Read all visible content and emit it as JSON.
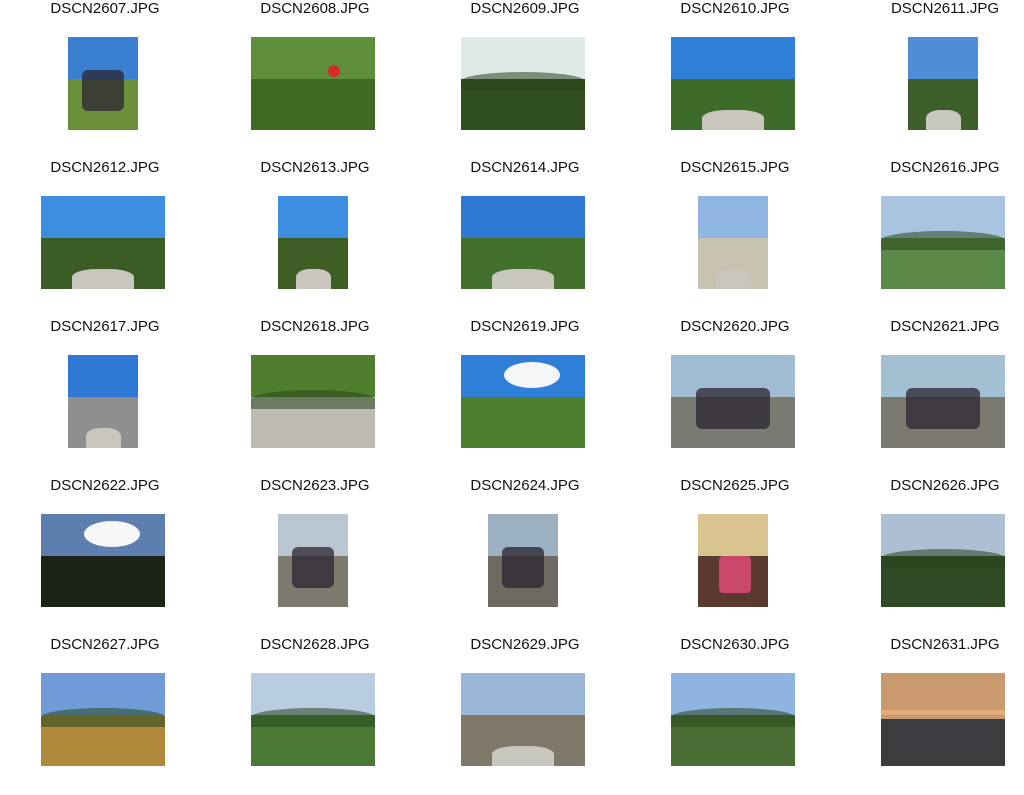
{
  "gallery": {
    "items": [
      {
        "filename": "DSCN2607.JPG",
        "orientation": "portrait",
        "scene": "people-grass",
        "sky": "#3a7fd0",
        "land": "#6c8f3c"
      },
      {
        "filename": "DSCN2608.JPG",
        "orientation": "landscape",
        "scene": "berry",
        "sky": "#5f8f3a",
        "land": "#3e6a22"
      },
      {
        "filename": "DSCN2609.JPG",
        "orientation": "landscape",
        "scene": "trees",
        "sky": "#dfe9e6",
        "land": "#2f4f1e"
      },
      {
        "filename": "DSCN2610.JPG",
        "orientation": "landscape",
        "scene": "hills-road",
        "sky": "#2f7fd8",
        "land": "#3d6b2a"
      },
      {
        "filename": "DSCN2611.JPG",
        "orientation": "portrait",
        "scene": "road-cliff",
        "sky": "#4f8ed6",
        "land": "#3e5f2a"
      },
      {
        "filename": "DSCN2612.JPG",
        "orientation": "landscape",
        "scene": "road-cliff",
        "sky": "#3d8de0",
        "land": "#3b5c25"
      },
      {
        "filename": "DSCN2613.JPG",
        "orientation": "portrait",
        "scene": "road-cliff",
        "sky": "#3d8de0",
        "land": "#3f5e26"
      },
      {
        "filename": "DSCN2614.JPG",
        "orientation": "landscape",
        "scene": "hills-road",
        "sky": "#2f78d4",
        "land": "#44702d"
      },
      {
        "filename": "DSCN2615.JPG",
        "orientation": "portrait",
        "scene": "person-road",
        "sky": "#8fb6e3",
        "land": "#c8c2b0"
      },
      {
        "filename": "DSCN2616.JPG",
        "orientation": "landscape",
        "scene": "valley",
        "sky": "#a9c4e0",
        "land": "#5b8a48"
      },
      {
        "filename": "DSCN2617.JPG",
        "orientation": "portrait",
        "scene": "person-road",
        "sky": "#2f78d4",
        "land": "#8f8f8f"
      },
      {
        "filename": "DSCN2618.JPG",
        "orientation": "landscape",
        "scene": "waterfall",
        "sky": "#4f7f2d",
        "land": "#bdbbb2"
      },
      {
        "filename": "DSCN2619.JPG",
        "orientation": "landscape",
        "scene": "garden",
        "sky": "#2f7fd8",
        "land": "#4b7f2e"
      },
      {
        "filename": "DSCN2620.JPG",
        "orientation": "landscape",
        "scene": "group",
        "sky": "#9fbcd0",
        "land": "#7a7a72"
      },
      {
        "filename": "DSCN2621.JPG",
        "orientation": "landscape",
        "scene": "group",
        "sky": "#a3bfd2",
        "land": "#7c7a70"
      },
      {
        "filename": "DSCN2622.JPG",
        "orientation": "landscape",
        "scene": "clouds",
        "sky": "#5d7fb0",
        "land": "#1c2418"
      },
      {
        "filename": "DSCN2623.JPG",
        "orientation": "portrait",
        "scene": "street",
        "sky": "#b9c6cf",
        "land": "#7d7a70"
      },
      {
        "filename": "DSCN2624.JPG",
        "orientation": "portrait",
        "scene": "street",
        "sky": "#9bb0c0",
        "land": "#6e6a62"
      },
      {
        "filename": "DSCN2625.JPG",
        "orientation": "portrait",
        "scene": "indoor",
        "sky": "#d9c48f",
        "land": "#5a3a2e"
      },
      {
        "filename": "DSCN2626.JPG",
        "orientation": "landscape",
        "scene": "motion-trees",
        "sky": "#aebfd4",
        "land": "#2f4a25"
      },
      {
        "filename": "DSCN2627.JPG",
        "orientation": "landscape",
        "scene": "hill-sunset",
        "sky": "#6f9cd8",
        "land": "#b08a3a"
      },
      {
        "filename": "DSCN2628.JPG",
        "orientation": "landscape",
        "scene": "valley",
        "sky": "#b9cde0",
        "land": "#4b7a35"
      },
      {
        "filename": "DSCN2629.JPG",
        "orientation": "landscape",
        "scene": "road-slope",
        "sky": "#9ab7d8",
        "land": "#7f7868"
      },
      {
        "filename": "DSCN2630.JPG",
        "orientation": "landscape",
        "scene": "village-hills",
        "sky": "#8eb4df",
        "land": "#4a6e34"
      },
      {
        "filename": "DSCN2631.JPG",
        "orientation": "landscape",
        "scene": "dusk",
        "sky": "#c99a6e",
        "land": "#3a3c40"
      }
    ]
  }
}
